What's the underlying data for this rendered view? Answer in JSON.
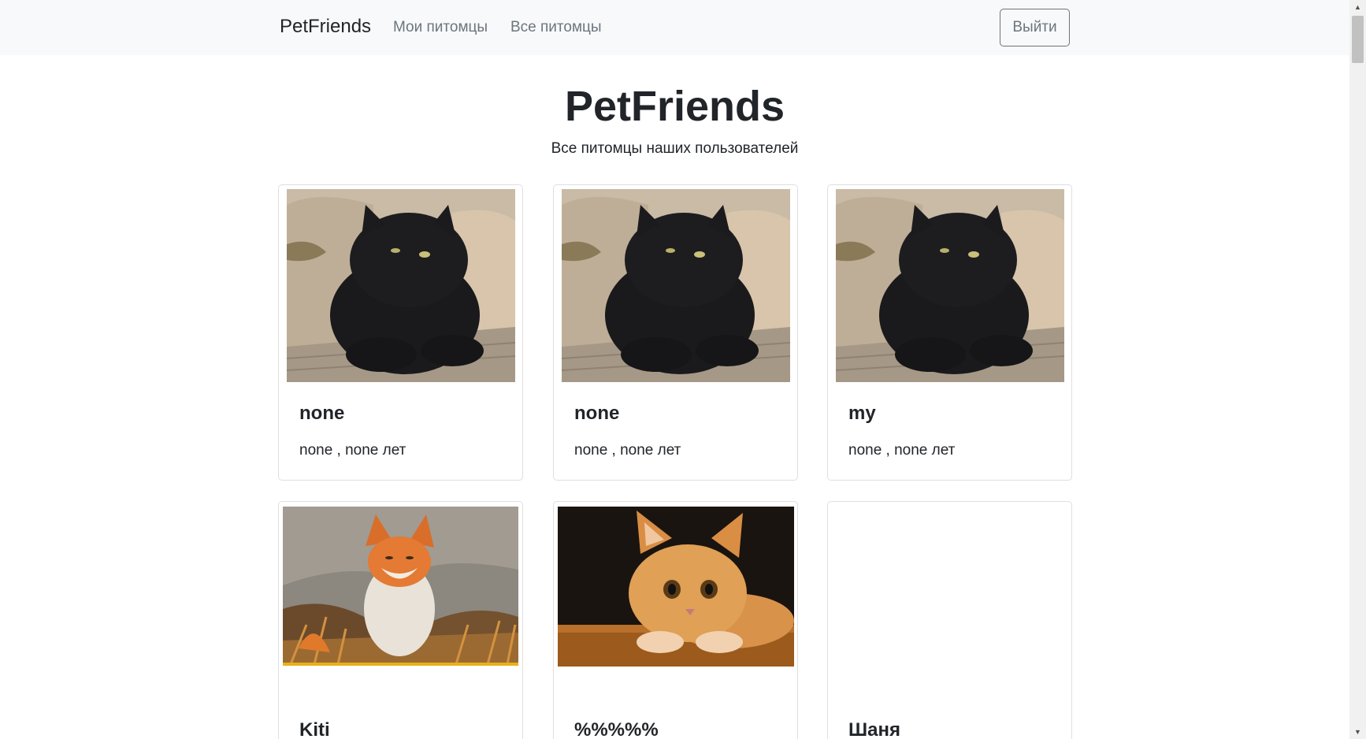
{
  "navbar": {
    "brand": "PetFriends",
    "links": [
      {
        "label": "Мои питомцы"
      },
      {
        "label": "Все питомцы"
      }
    ],
    "logout_label": "Выйти"
  },
  "page": {
    "title": "PetFriends",
    "subtitle": "Все питомцы наших пользователей"
  },
  "pets": [
    {
      "name": "none",
      "meta": "none , none лет",
      "photo": "black-cat-photo"
    },
    {
      "name": "none",
      "meta": "none , none лет",
      "photo": "black-cat-photo"
    },
    {
      "name": "my",
      "meta": "none , none лет",
      "photo": "black-cat-photo"
    },
    {
      "name": "Kiti",
      "photo": "fox-painting-photo"
    },
    {
      "name": "%%%%%",
      "photo": "ginger-kitten-photo"
    },
    {
      "name": "Шаня",
      "photo": ""
    }
  ],
  "colors": {
    "navbar_bg": "#f8f9fa",
    "text": "#212529",
    "muted": "#6c757d",
    "card_border": "#dfdfdf"
  }
}
